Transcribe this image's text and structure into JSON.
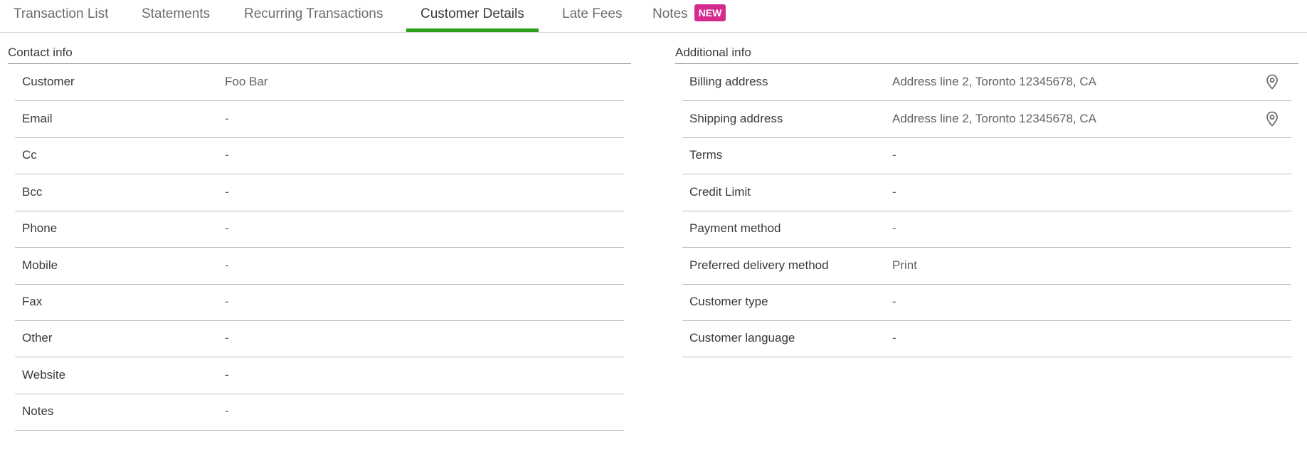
{
  "tabs": [
    {
      "label": "Transaction List",
      "active": false
    },
    {
      "label": "Statements",
      "active": false
    },
    {
      "label": "Recurring Transactions",
      "active": false
    },
    {
      "label": "Customer Details",
      "active": true
    },
    {
      "label": "Late Fees",
      "active": false
    },
    {
      "label": "Notes",
      "active": false,
      "badge": "NEW"
    }
  ],
  "contact": {
    "title": "Contact info",
    "rows": [
      {
        "label": "Customer",
        "value": "Foo Bar"
      },
      {
        "label": "Email",
        "value": "-"
      },
      {
        "label": "Cc",
        "value": "-"
      },
      {
        "label": "Bcc",
        "value": "-"
      },
      {
        "label": "Phone",
        "value": "-"
      },
      {
        "label": "Mobile",
        "value": "-"
      },
      {
        "label": "Fax",
        "value": "-"
      },
      {
        "label": "Other",
        "value": "-"
      },
      {
        "label": "Website",
        "value": "-"
      },
      {
        "label": "Notes",
        "value": "-"
      }
    ]
  },
  "additional": {
    "title": "Additional info",
    "rows": [
      {
        "label": "Billing address",
        "value": "Address line 2, Toronto 12345678, CA",
        "icon": "map-pin-icon"
      },
      {
        "label": "Shipping address",
        "value": "Address line 2, Toronto 12345678, CA",
        "icon": "map-pin-icon"
      },
      {
        "label": "Terms",
        "value": "-"
      },
      {
        "label": "Credit Limit",
        "value": "-"
      },
      {
        "label": "Payment method",
        "value": "-"
      },
      {
        "label": "Preferred delivery method",
        "value": "Print"
      },
      {
        "label": "Customer type",
        "value": "-"
      },
      {
        "label": "Customer language",
        "value": "-"
      }
    ]
  },
  "colors": {
    "active_tab_underline": "#2ca01c",
    "new_badge": "#d52b8f"
  }
}
